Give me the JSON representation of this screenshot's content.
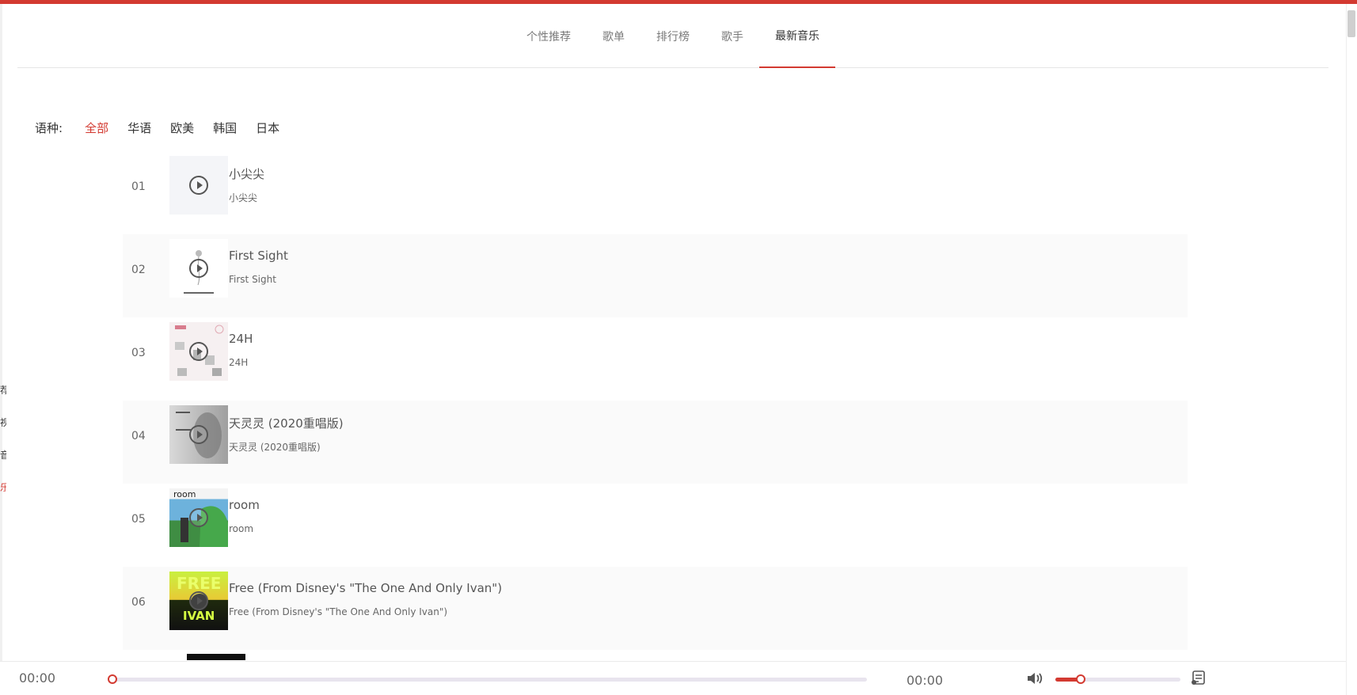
{
  "nav": {
    "tabs": [
      {
        "label": "个性推荐",
        "active": false
      },
      {
        "label": "歌单",
        "active": false
      },
      {
        "label": "排行榜",
        "active": false
      },
      {
        "label": "歌手",
        "active": false
      },
      {
        "label": "最新音乐",
        "active": true
      }
    ]
  },
  "language_filter": {
    "label": "语种:",
    "options": [
      "全部",
      "华语",
      "欧美",
      "韩国",
      "日本"
    ],
    "selected": "全部"
  },
  "songs": [
    {
      "number": "01",
      "title": "小尖尖",
      "subtitle": "小尖尖",
      "cover_icon": "play-icon"
    },
    {
      "number": "02",
      "title": "First Sight",
      "subtitle": "First Sight",
      "cover_icon": "play-icon"
    },
    {
      "number": "03",
      "title": "24H",
      "subtitle": "24H",
      "cover_icon": "play-icon"
    },
    {
      "number": "04",
      "title": "天灵灵 (2020重唱版)",
      "subtitle": "天灵灵 (2020重唱版)",
      "cover_icon": "play-icon"
    },
    {
      "number": "05",
      "title": "room",
      "subtitle": "room",
      "cover_icon": "play-icon"
    },
    {
      "number": "06",
      "title": "Free (From Disney's \"The One And Only Ivan\")",
      "subtitle": "Free (From Disney's \"The One And Only Ivan\")",
      "cover_icon": "play-icon"
    }
  ],
  "player": {
    "current_time": "00:00",
    "duration": "00:00",
    "progress": 0,
    "volume": 0.2,
    "icons": [
      "volume-icon",
      "playlist-icon"
    ]
  },
  "colors": {
    "accent": "#d33a31",
    "text": "#333333",
    "muted": "#7a7a7a",
    "row_alt": "#fafafa"
  }
}
